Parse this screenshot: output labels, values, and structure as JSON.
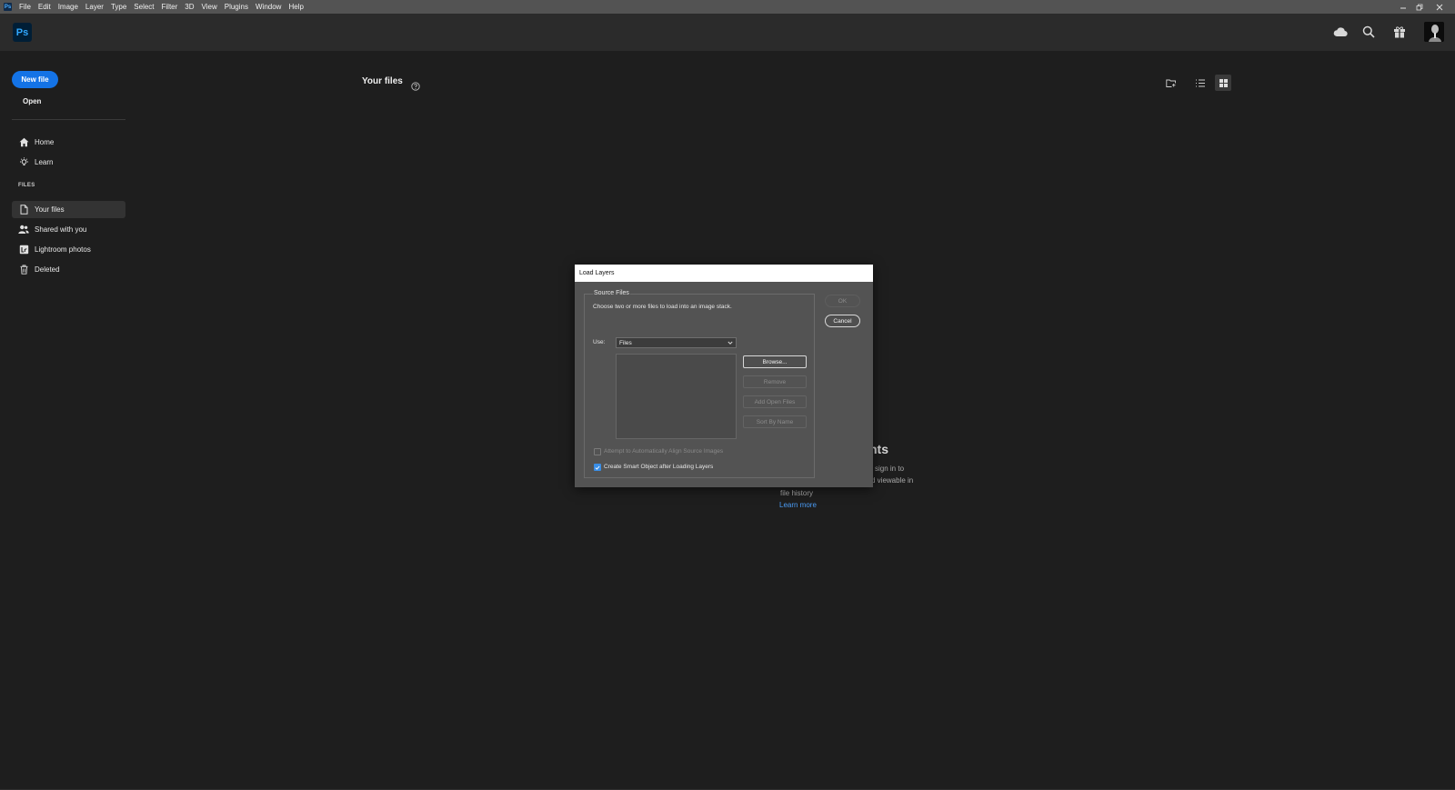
{
  "menubar": {
    "app_badge": "Ps",
    "items": [
      "File",
      "Edit",
      "Image",
      "Layer",
      "Type",
      "Select",
      "Filter",
      "3D",
      "View",
      "Plugins",
      "Window",
      "Help"
    ],
    "controls": [
      "minimize",
      "restore",
      "close"
    ]
  },
  "header": {
    "logo": "Ps",
    "icons": [
      "cloud-icon",
      "search-icon",
      "gift-icon",
      "avatar"
    ]
  },
  "sidebar": {
    "new_file": "New file",
    "open": "Open",
    "nav": [
      {
        "label": "Home",
        "icon": "home-icon"
      },
      {
        "label": "Learn",
        "icon": "lightbulb-icon"
      }
    ],
    "section_label": "FILES",
    "files": [
      {
        "label": "Your files",
        "icon": "document-icon",
        "active": true
      },
      {
        "label": "Shared with you",
        "icon": "people-icon",
        "active": false
      },
      {
        "label": "Lightroom photos",
        "icon": "lightroom-icon",
        "active": false
      },
      {
        "label": "Deleted",
        "icon": "trash-icon",
        "active": false
      }
    ]
  },
  "main": {
    "title": "Your files",
    "empty_state": {
      "title_fragment": "nts",
      "line1_fragment": "sign in to",
      "line2_fragment": "d viewable in",
      "line3": "file history",
      "learn_more": "Learn more"
    }
  },
  "dialog": {
    "title": "Load Layers",
    "group_label": "Source Files",
    "instructions": "Choose two or more files to load into an image stack.",
    "use_label": "Use:",
    "use_value": "Files",
    "buttons": {
      "ok": "OK",
      "cancel": "Cancel",
      "browse": "Browse...",
      "remove": "Remove",
      "add_open_files": "Add Open Files",
      "sort_by_name": "Sort By Name"
    },
    "checkboxes": {
      "align": {
        "label": "Attempt to Automatically Align Source Images",
        "checked": false,
        "enabled": false
      },
      "smart_object": {
        "label": "Create Smart Object after Loading Layers",
        "checked": true,
        "enabled": true
      }
    }
  },
  "colors": {
    "accent": "#1473e6",
    "link": "#4b9cf5",
    "background": "#1e1e1e",
    "dialog": "#535353"
  }
}
